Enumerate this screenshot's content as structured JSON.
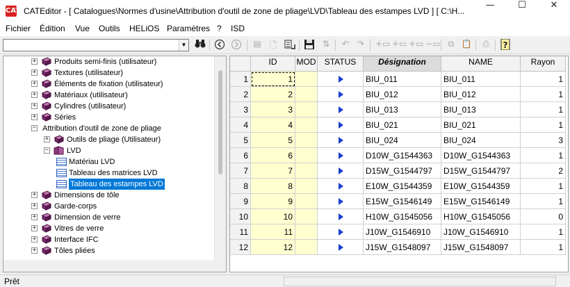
{
  "window": {
    "app_icon": "CAT",
    "title": "CATEditor - [ Catalogues\\Normes d'usine\\Attribution d'outil de zone de pliage\\LVD\\Tableau des estampes LVD ]     [ C:\\H..."
  },
  "menu": [
    "Fichier",
    "Édition",
    "Vue",
    "Outils",
    "HELiOS",
    "Paramètres",
    "?",
    "ISD"
  ],
  "toolbar": {
    "combo_value": "",
    "icons": [
      "binoculars-icon",
      "back-icon",
      "forward-icon",
      "insert-icon",
      "new-document-icon",
      "import-table-icon",
      "save-icon",
      "sort-icon",
      "undo-icon",
      "redo-icon",
      "add-row-icon",
      "insert-row-icon",
      "append-row-icon",
      "delete-row-icon",
      "copy-icon",
      "paste-icon",
      "print-icon",
      "help-icon"
    ]
  },
  "tree": [
    {
      "label": "Produits semi-finis (utilisateur)",
      "level": 0,
      "expander": "+",
      "icon": "book"
    },
    {
      "label": "Textures (utilisateur)",
      "level": 0,
      "expander": "+",
      "icon": "book"
    },
    {
      "label": "Éléments de fixation (utilisateur)",
      "level": 0,
      "expander": "+",
      "icon": "book"
    },
    {
      "label": "Matériaux (utilisateur)",
      "level": 0,
      "expander": "+",
      "icon": "book"
    },
    {
      "label": "Cylindres (utilisateur)",
      "level": 0,
      "expander": "+",
      "icon": "book"
    },
    {
      "label": "Séries",
      "level": 0,
      "expander": "+",
      "icon": "book"
    },
    {
      "label": "Attribution d'outil de zone de pliage",
      "level": 0,
      "expander": "-",
      "icon": "none"
    },
    {
      "label": "Outils de pliage (Utilisateur)",
      "level": 1,
      "expander": "+",
      "icon": "book"
    },
    {
      "label": "LVD",
      "level": 1,
      "expander": "-",
      "icon": "book-open"
    },
    {
      "label": "Matériau LVD",
      "level": 2,
      "expander": "",
      "icon": "table"
    },
    {
      "label": "Tableau des matrices LVD",
      "level": 2,
      "expander": "",
      "icon": "table"
    },
    {
      "label": "Tableau des estampes LVD",
      "level": 2,
      "expander": "",
      "icon": "table",
      "selected": true
    },
    {
      "label": "Dimensions de tôle",
      "level": 0,
      "expander": "+",
      "icon": "book"
    },
    {
      "label": "Garde-corps",
      "level": 0,
      "expander": "+",
      "icon": "book"
    },
    {
      "label": "Dimension de verre",
      "level": 0,
      "expander": "+",
      "icon": "book"
    },
    {
      "label": "Vitres de verre",
      "level": 0,
      "expander": "+",
      "icon": "book"
    },
    {
      "label": "Interface IFC",
      "level": 0,
      "expander": "+",
      "icon": "book"
    },
    {
      "label": "Tôles pliées",
      "level": 0,
      "expander": "+",
      "icon": "book"
    }
  ],
  "grid": {
    "headers": [
      "",
      "ID",
      "MOD",
      "STATUS",
      "Désignation",
      "NAME",
      "Rayon"
    ],
    "rows": [
      {
        "rn": "1",
        "id": "1",
        "mod": "",
        "desig": "BIU_011",
        "name": "BIU_011",
        "rayon": "1"
      },
      {
        "rn": "2",
        "id": "2",
        "mod": "",
        "desig": "BIU_012",
        "name": "BIU_012",
        "rayon": "1"
      },
      {
        "rn": "3",
        "id": "3",
        "mod": "",
        "desig": "BIU_013",
        "name": "BIU_013",
        "rayon": "1"
      },
      {
        "rn": "4",
        "id": "4",
        "mod": "",
        "desig": "BIU_021",
        "name": "BIU_021",
        "rayon": "1"
      },
      {
        "rn": "5",
        "id": "5",
        "mod": "",
        "desig": "BIU_024",
        "name": "BIU_024",
        "rayon": "3"
      },
      {
        "rn": "6",
        "id": "6",
        "mod": "",
        "desig": "D10W_G1544363",
        "name": "D10W_G1544363",
        "rayon": "1"
      },
      {
        "rn": "7",
        "id": "7",
        "mod": "",
        "desig": "D15W_G1544797",
        "name": "D15W_G1544797",
        "rayon": "2"
      },
      {
        "rn": "8",
        "id": "8",
        "mod": "",
        "desig": "E10W_G1544359",
        "name": "E10W_G1544359",
        "rayon": "1"
      },
      {
        "rn": "9",
        "id": "9",
        "mod": "",
        "desig": "E15W_G1546149",
        "name": "E15W_G1546149",
        "rayon": "1"
      },
      {
        "rn": "10",
        "id": "10",
        "mod": "",
        "desig": "H10W_G1545056",
        "name": "H10W_G1545056",
        "rayon": "0"
      },
      {
        "rn": "11",
        "id": "11",
        "mod": "",
        "desig": "J10W_G1546910",
        "name": "J10W_G1546910",
        "rayon": "1"
      },
      {
        "rn": "12",
        "id": "12",
        "mod": "",
        "desig": "J15W_G1548097",
        "name": "J15W_G1548097",
        "rayon": "1"
      }
    ]
  },
  "status": {
    "text": "Prêt"
  },
  "colors": {
    "selection": "#0078d7",
    "id_column_bg": "#ffffd0",
    "status_arrow": "#1a3fd0",
    "book_icon": "#7a2a6a"
  }
}
